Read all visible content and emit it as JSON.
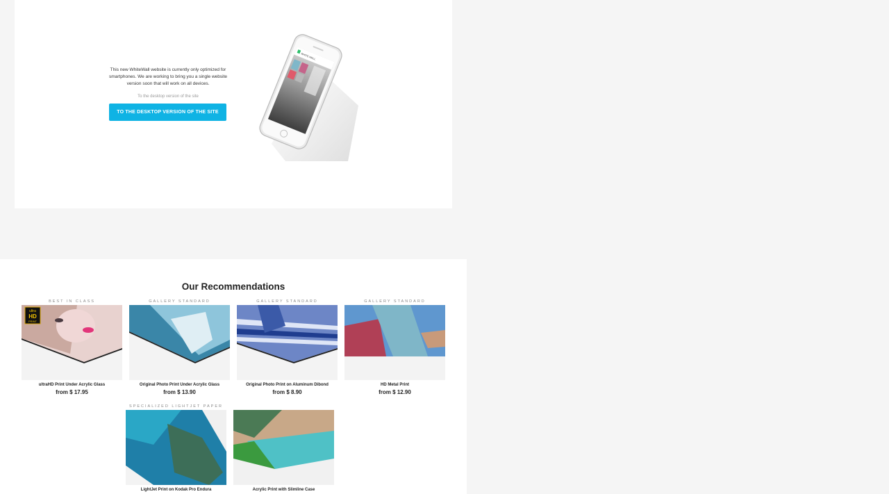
{
  "notice": {
    "message": "This new WhiteWall website is currently only optimized for smartphones. We are working to bring you a single website version soon that will work on all devices.",
    "desktop_link": "To the desktop version of the site",
    "desktop_button": "TO THE DESKTOP VERSION OF THE SITE",
    "phone_brand": "WHITE WALL"
  },
  "recommendations": {
    "title": "Our Recommendations",
    "products": [
      {
        "category": "BEST IN CLASS",
        "name": "ultraHD Print Under Acrylic Glass",
        "price": "from $ 17.95",
        "badge_lines": [
          "ultra",
          "HD",
          "PRINT"
        ]
      },
      {
        "category": "GALLERY STANDARD",
        "name": "Original Photo Print Under Acrylic Glass",
        "price": "from $ 13.90"
      },
      {
        "category": "GALLERY STANDARD",
        "name": "Original Photo Print on Aluminum Dibond",
        "price": "from $ 8.90"
      },
      {
        "category": "GALLERY STANDARD",
        "name": "HD Metal Print",
        "price": "from $ 12.90"
      },
      {
        "category": "SPECIALIZED LIGHTJET PAPER",
        "name": "LightJet Print on Kodak Pro Endura",
        "price": ""
      },
      {
        "category": "",
        "name": "Acrylic Print with Slimline Case",
        "price": ""
      }
    ]
  }
}
